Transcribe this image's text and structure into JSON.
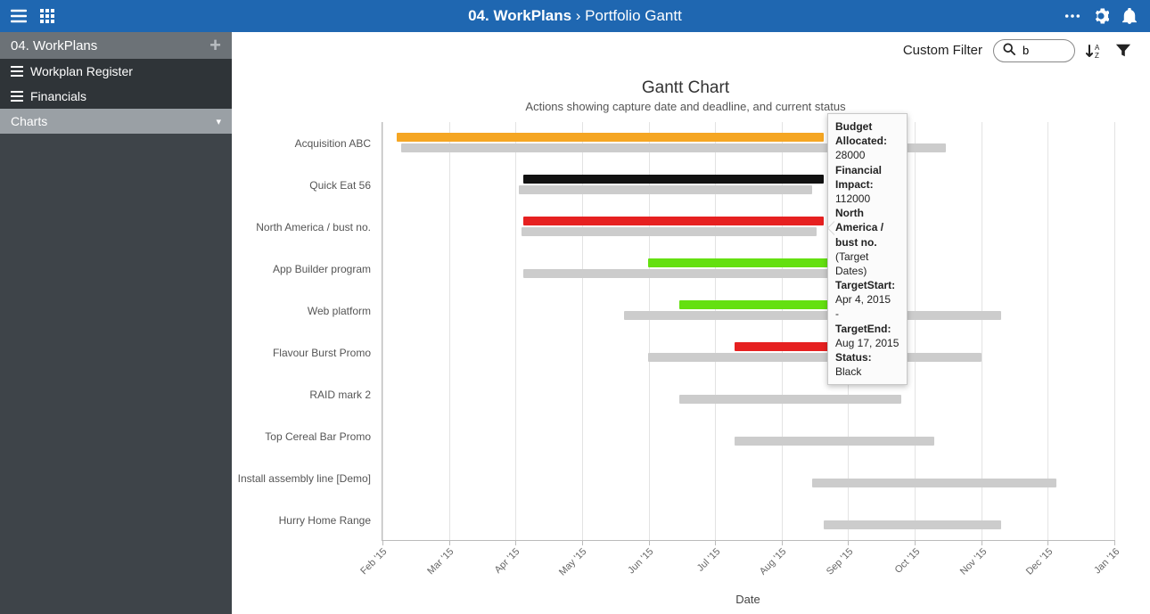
{
  "header": {
    "crumb1": "04. WorkPlans",
    "sep": " › ",
    "crumb2": "Portfolio Gantt"
  },
  "sidebar": {
    "header": "04. WorkPlans",
    "items": [
      {
        "label": "Workplan Register",
        "icon": "list-icon",
        "active": false
      },
      {
        "label": "Financials",
        "icon": "list-icon",
        "active": false
      },
      {
        "label": "Charts",
        "icon": "",
        "active": true,
        "hasChevron": true
      }
    ]
  },
  "toolbar": {
    "filter_label": "Custom Filter",
    "search_value": "b"
  },
  "chart": {
    "title": "Gantt Chart",
    "subtitle": "Actions showing capture date and deadline, and current status",
    "x_axis_title": "Date"
  },
  "tooltip": {
    "k1": "Budget Allocated:",
    "v1": "28000",
    "k2": "Financial Impact:",
    "v2": "112000",
    "name1": "North America / bust no.",
    "name2": "(Target Dates)",
    "k3": "TargetStart:",
    "v3a": "Apr 4, 2015",
    "v3sep": "-",
    "k4": "TargetEnd:",
    "v4": "Aug 17, 2015",
    "k5": "Status:",
    "v5": "Black"
  },
  "chart_data": {
    "type": "gantt",
    "title": "Gantt Chart",
    "subtitle": "Actions showing capture date and deadline, and current status",
    "xlabel": "Date",
    "x_ticks": [
      "Feb '15",
      "Mar '15",
      "Apr '15",
      "May '15",
      "Jun '15",
      "Jul '15",
      "Aug '15",
      "Sep '15",
      "Oct '15",
      "Nov '15",
      "Dec '15",
      "Jan '16"
    ],
    "x_range_months": {
      "start": "2015-02",
      "end": "2016-01"
    },
    "categories": [
      "Acquisition ABC",
      "Quick Eat 56",
      "North America / bust no.",
      "App Builder program",
      "Web platform",
      "Flavour Burst Promo",
      "RAID mark 2",
      "Top Cereal Bar Promo",
      "Install assembly line [Demo]",
      "Hurry Home Range"
    ],
    "series": [
      {
        "name": "Target Dates",
        "color": "#cccccc",
        "bars": [
          {
            "category": "Acquisition ABC",
            "start": "2015-02-10",
            "end": "2015-10-15"
          },
          {
            "category": "Quick Eat 56",
            "start": "2015-04-03",
            "end": "2015-08-15"
          },
          {
            "category": "North America / bust no.",
            "start": "2015-04-04",
            "end": "2015-08-17"
          },
          {
            "category": "App Builder program",
            "start": "2015-04-05",
            "end": "2015-08-25"
          },
          {
            "category": "Web platform",
            "start": "2015-05-20",
            "end": "2015-11-10"
          },
          {
            "category": "Flavour Burst Promo",
            "start": "2015-06-01",
            "end": "2015-11-01"
          },
          {
            "category": "RAID mark 2",
            "start": "2015-06-15",
            "end": "2015-09-25"
          },
          {
            "category": "Top Cereal Bar Promo",
            "start": "2015-07-10",
            "end": "2015-10-10"
          },
          {
            "category": "Install assembly line [Demo]",
            "start": "2015-08-15",
            "end": "2015-12-05"
          },
          {
            "category": "Hurry Home Range",
            "start": "2015-08-20",
            "end": "2015-11-10"
          }
        ]
      },
      {
        "name": "Status",
        "bars": [
          {
            "category": "Acquisition ABC",
            "start": "2015-02-08",
            "end": "2015-08-20",
            "color": "#f5a623",
            "status": "Amber"
          },
          {
            "category": "Quick Eat 56",
            "start": "2015-04-05",
            "end": "2015-08-20",
            "color": "#111111",
            "status": "Black"
          },
          {
            "category": "North America / bust no.",
            "start": "2015-04-05",
            "end": "2015-08-20",
            "color": "#e62020",
            "status": "Red"
          },
          {
            "category": "App Builder program",
            "start": "2015-06-01",
            "end": "2015-08-25",
            "color": "#64e010",
            "status": "Green"
          },
          {
            "category": "Web platform",
            "start": "2015-06-15",
            "end": "2015-08-25",
            "color": "#64e010",
            "status": "Green"
          },
          {
            "category": "Flavour Burst Promo",
            "start": "2015-07-10",
            "end": "2015-08-25",
            "color": "#e62020",
            "status": "Red"
          }
        ]
      }
    ],
    "hover_detail": {
      "category": "North America / bust no.",
      "Budget Allocated": 28000,
      "Financial Impact": 112000,
      "TargetStart": "Apr 4, 2015",
      "TargetEnd": "Aug 17, 2015",
      "Status": "Black"
    }
  }
}
